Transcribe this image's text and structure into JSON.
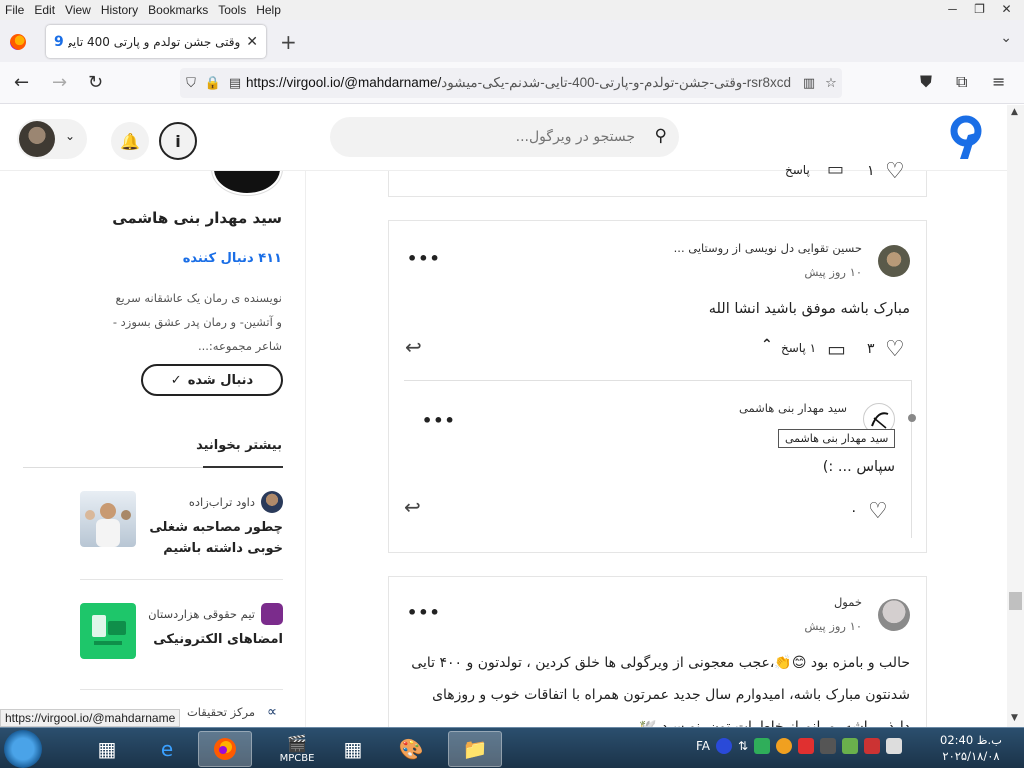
{
  "browser": {
    "menu": [
      "File",
      "Edit",
      "View",
      "History",
      "Bookmarks",
      "Tools",
      "Help"
    ],
    "tab_title": "وقتی جشن تولدم و پارتی 400 تایی",
    "url_prefix": "https://virgool.io/@mahdarname/",
    "url_rest": "وقتی-جشن-تولدم-و-پارتی-400-تایی-شدنم-یکی-میشود-rsr8xcd",
    "status_url": "https://virgool.io/@mahdarname"
  },
  "header": {
    "search_placeholder": "جستجو در ویرگول..."
  },
  "sidebar": {
    "author_name": "سید مهدار بنی هاشمی",
    "followers": "۴۱۱ دنبال کننده",
    "bio": "نویسنده ی رمان یک عاشقانه سریع و آتشین- و رمان پدر عشق بسوزد - شاعر مجموعه:...",
    "follow_label": "دنبال شده",
    "more_to_read": "بیشتر بخوانید",
    "recs": [
      {
        "author": "داود تراب‌زاده",
        "title": "چطور مصاحبه شغلی خوبی داشته باشیم"
      },
      {
        "author": "تیم حقوقی هزاردستان",
        "title": "امضاهای الکترونیکی"
      },
      {
        "author": "مرکز تحقیقات"
      }
    ]
  },
  "comments": {
    "top_partial": {
      "likes": "۱",
      "replies": "پاسخ"
    },
    "c1": {
      "author": "حسین تقوایی دل نویسی از روستایی ...",
      "time": "۱۰ روز پیش",
      "body": "مبارک باشه موفق باشید انشا الله",
      "likes": "۳",
      "replies": "۱ پاسخ"
    },
    "c1_reply": {
      "author": "سید مهدار بنی هاشمی",
      "tooltip": "سید مهدار بنی هاشمی",
      "body": "سپاس ... :)",
      "likes": "۰"
    },
    "c2": {
      "author": "خمول",
      "time": "۱۰ روز پیش",
      "body": "حالب و بامزه بود 😊👏،عجب معجونی از ویرگولی ها خلق کردین ، تولدتون و ۴۰۰ تایی شدنتون مبارک باشه، امیدوارم سال جدید عمرتون همراه با اتفاقات خوب و روزهای دلپذیر باشه. مرانم از خاطرات تون بنویسید 🕊️"
    }
  },
  "taskbar": {
    "lang": "FA",
    "time": "ب.ظ 02:40",
    "date": "۲۰۲۵/۱۸/۰۸",
    "mpc_label": "MPCBE"
  },
  "colors": {
    "accent": "#1a6ee6",
    "taskbar": "#1b3349"
  }
}
